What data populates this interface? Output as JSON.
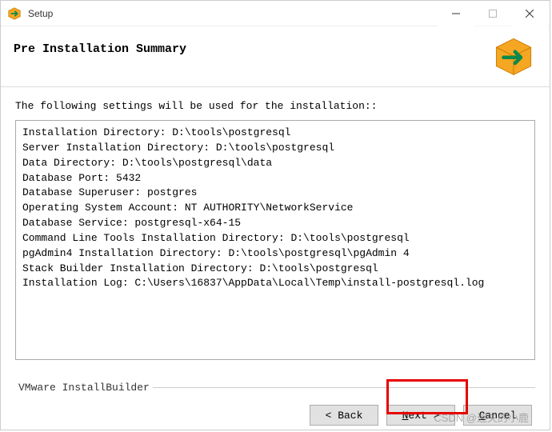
{
  "window": {
    "title": "Setup"
  },
  "header": {
    "page_title": "Pre Installation Summary"
  },
  "content": {
    "instruction": "The following settings will be used for the installation::",
    "summary_lines": [
      "Installation Directory: D:\\tools\\postgresql",
      "Server Installation Directory: D:\\tools\\postgresql",
      "Data Directory: D:\\tools\\postgresql\\data",
      "Database Port: 5432",
      "Database Superuser: postgres",
      "Operating System Account: NT AUTHORITY\\NetworkService",
      "Database Service: postgresql-x64-15",
      "Command Line Tools Installation Directory: D:\\tools\\postgresql",
      "pgAdmin4 Installation Directory: D:\\tools\\postgresql\\pgAdmin 4",
      "Stack Builder Installation Directory: D:\\tools\\postgresql",
      "Installation Log: C:\\Users\\16837\\AppData\\Local\\Temp\\install-postgresql.log"
    ]
  },
  "footer": {
    "brand": "VMware InstallBuilder",
    "buttons": {
      "back": "< Back",
      "next_prefix": "N",
      "next_rest": "ext >",
      "cancel_prefix": "C",
      "cancel_rest": "ancel"
    }
  },
  "watermark": "CSDN @迷失的小鹿"
}
